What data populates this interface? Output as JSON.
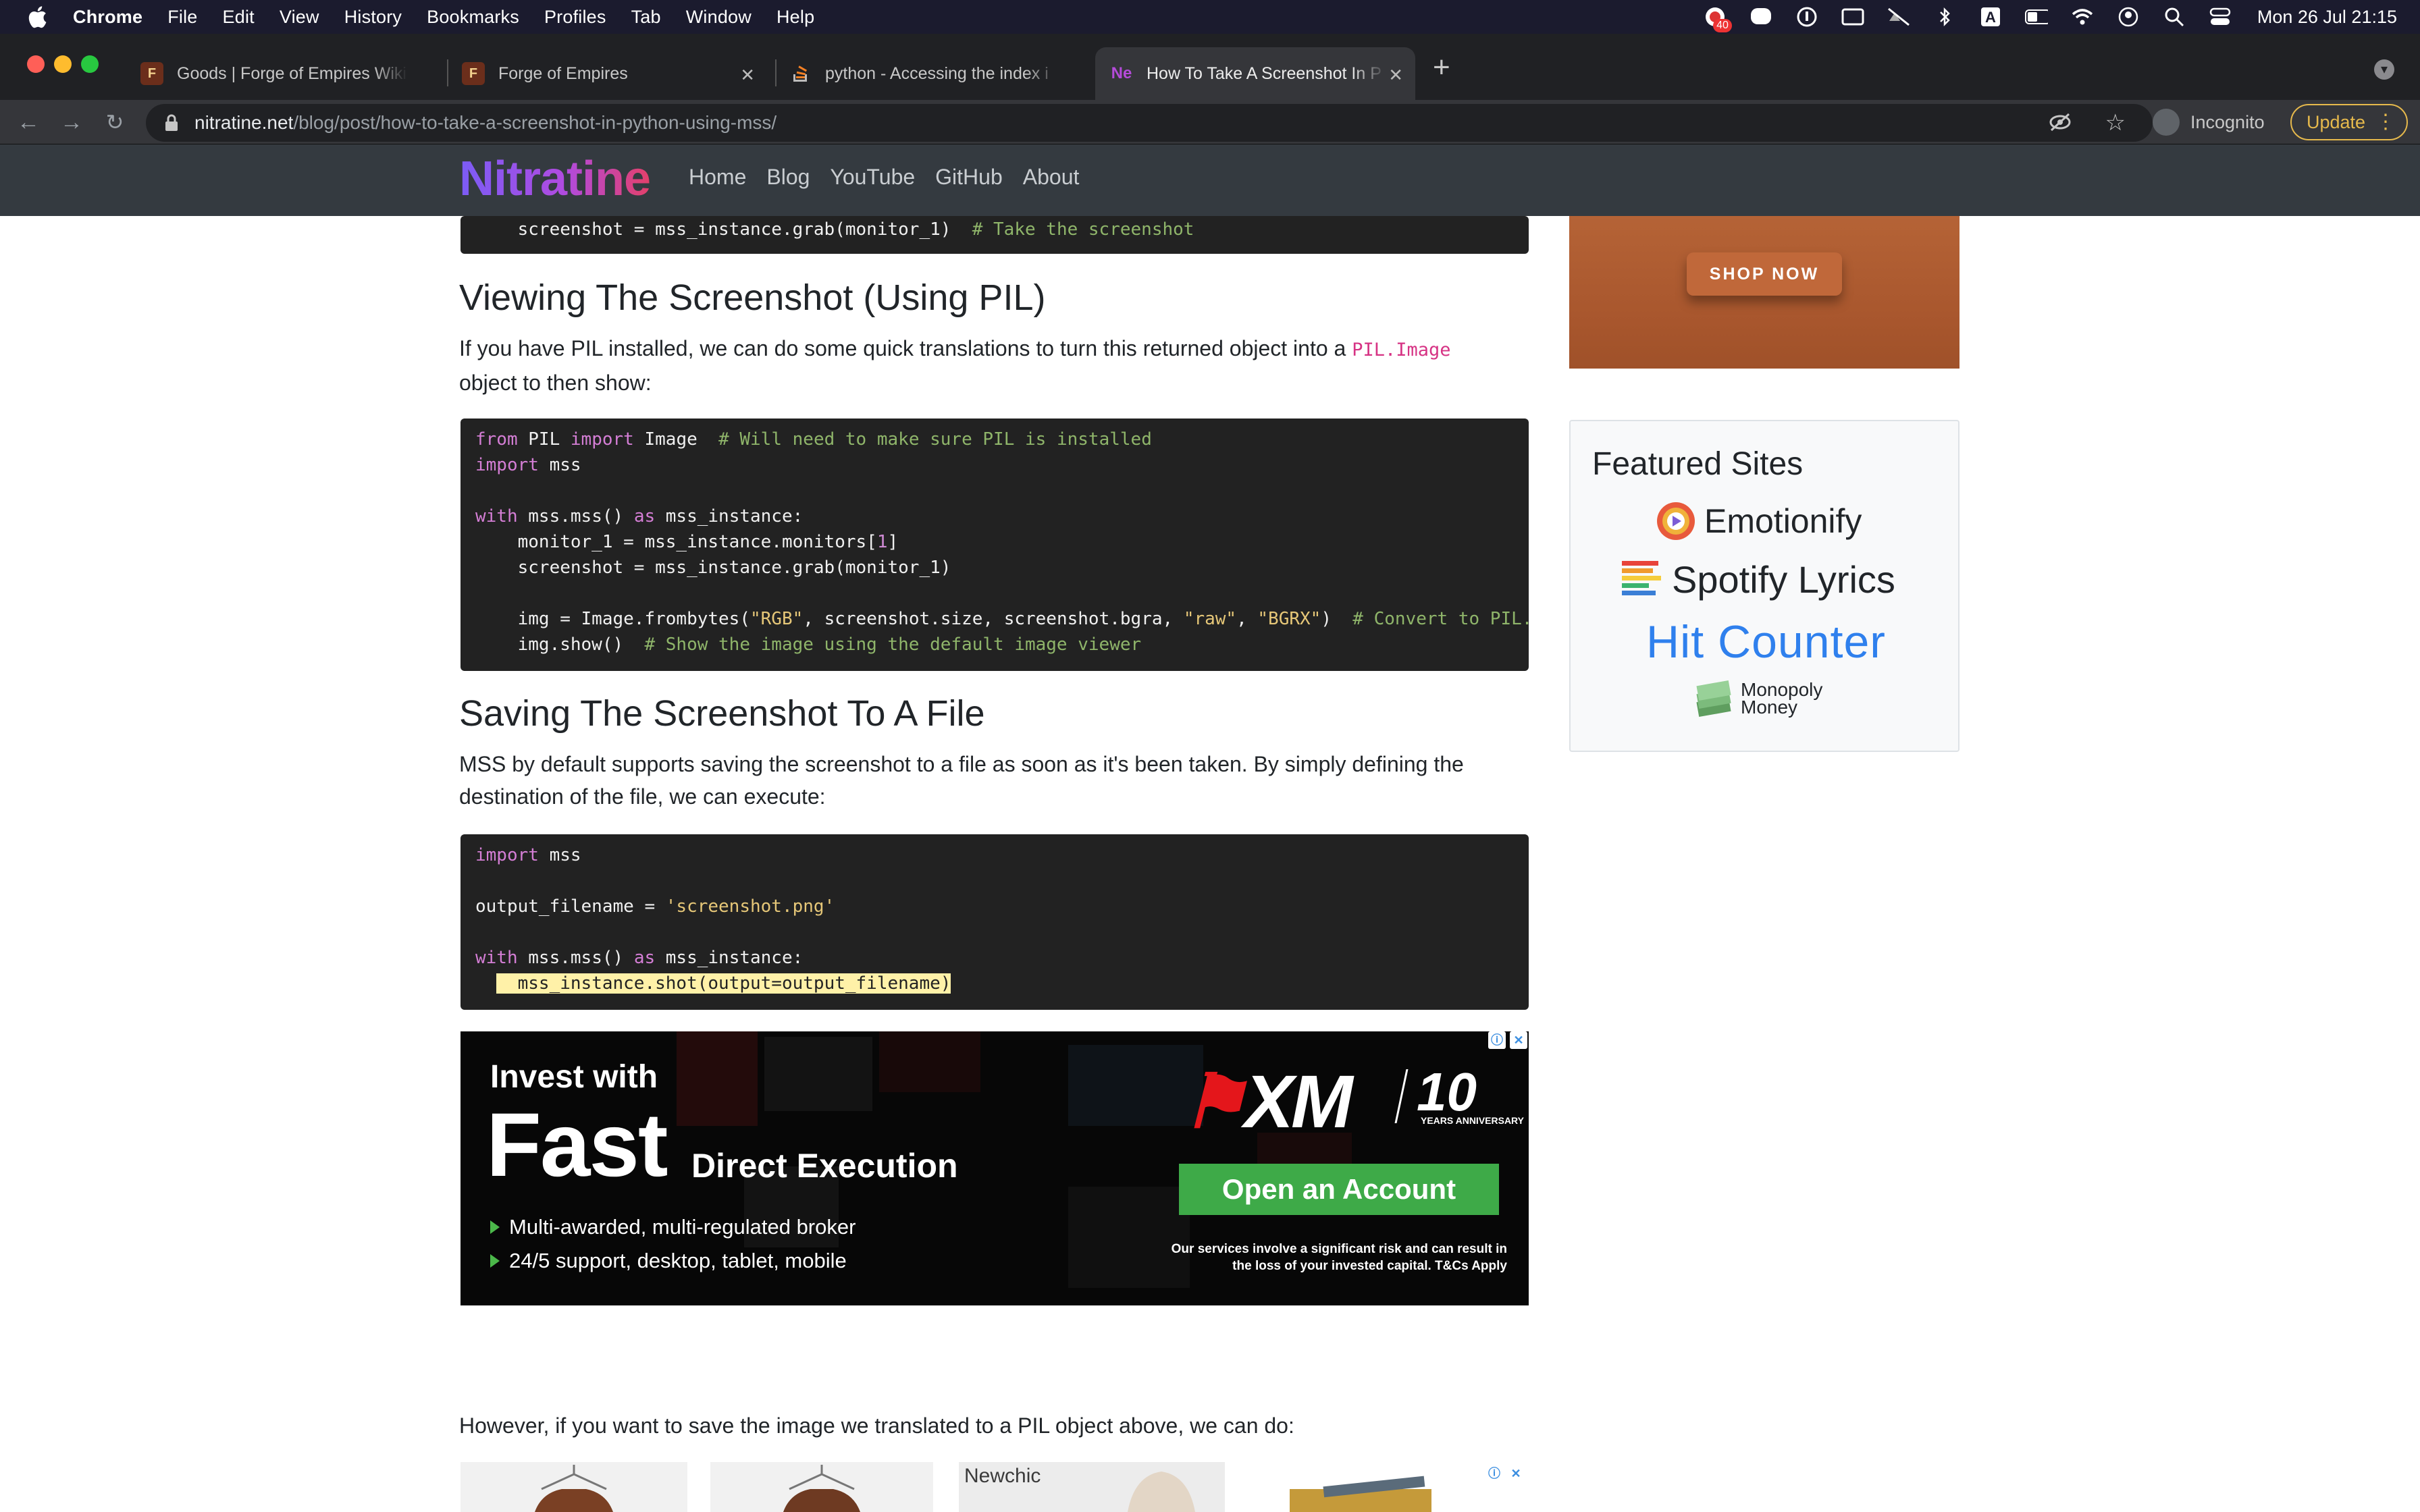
{
  "menubar": {
    "app": "Chrome",
    "items": [
      "File",
      "Edit",
      "View",
      "History",
      "Bookmarks",
      "Profiles",
      "Tab",
      "Window",
      "Help"
    ],
    "badge_count": "40",
    "clock": "Mon 26 Jul  21:15"
  },
  "tabs": [
    {
      "title": "Goods | Forge of Empires Wiki",
      "favicon": "F"
    },
    {
      "title": "Forge of Empires",
      "favicon": "F"
    },
    {
      "title": "python - Accessing the index i",
      "favicon": "so"
    },
    {
      "title": "How To Take A Screenshot In P",
      "favicon": "Ne",
      "active": true
    }
  ],
  "omnibox": {
    "host": "nitratine.net",
    "path": "/blog/post/how-to-take-a-screenshot-in-python-using-mss/"
  },
  "toolbar": {
    "incognito_label": "Incognito",
    "update_label": "Update"
  },
  "site": {
    "brand": "Nitratine",
    "nav": [
      "Home",
      "Blog",
      "YouTube",
      "GitHub",
      "About"
    ]
  },
  "article": {
    "top_code_line": {
      "code": "    screenshot = mss_instance.grab(monitor_1)  ",
      "comment": "# Take the screenshot"
    },
    "h_view": "Viewing The Screenshot (Using PIL)",
    "p_view_a": "If you have PIL installed, we can do some quick translations to turn this returned object into a ",
    "p_view_code": "PIL.Image",
    "p_view_b": "object to then show:",
    "h_save": "Saving The Screenshot To A File",
    "p_save": "MSS by default supports saving the screenshot to a file as soon as it's been taken. By simply defining the destination of the file, we can execute:",
    "p_however": "However, if you want to save the image we translated to a PIL object above, we can do:"
  },
  "ad_xm": {
    "invest": "Invest with",
    "fast": "Fast",
    "direct": "Direct Execution",
    "bullets": [
      "Multi-awarded, multi-regulated broker",
      "24/5 support, desktop, tablet, mobile"
    ],
    "logo": "XM",
    "years": "10",
    "years_sub": "YEARS ANNIVERSARY",
    "cta": "Open an Account",
    "risk": "Our services involve a significant risk and can result in the loss of your invested capital. T&Cs Apply"
  },
  "sidebar": {
    "shop_now": "SHOP NOW",
    "featured_title": "Featured Sites",
    "sites": [
      "Emotionify",
      "Spotify Lyrics",
      "Hit Counter",
      "Monopoly Money"
    ]
  },
  "products": {
    "brand": "Newchic"
  }
}
